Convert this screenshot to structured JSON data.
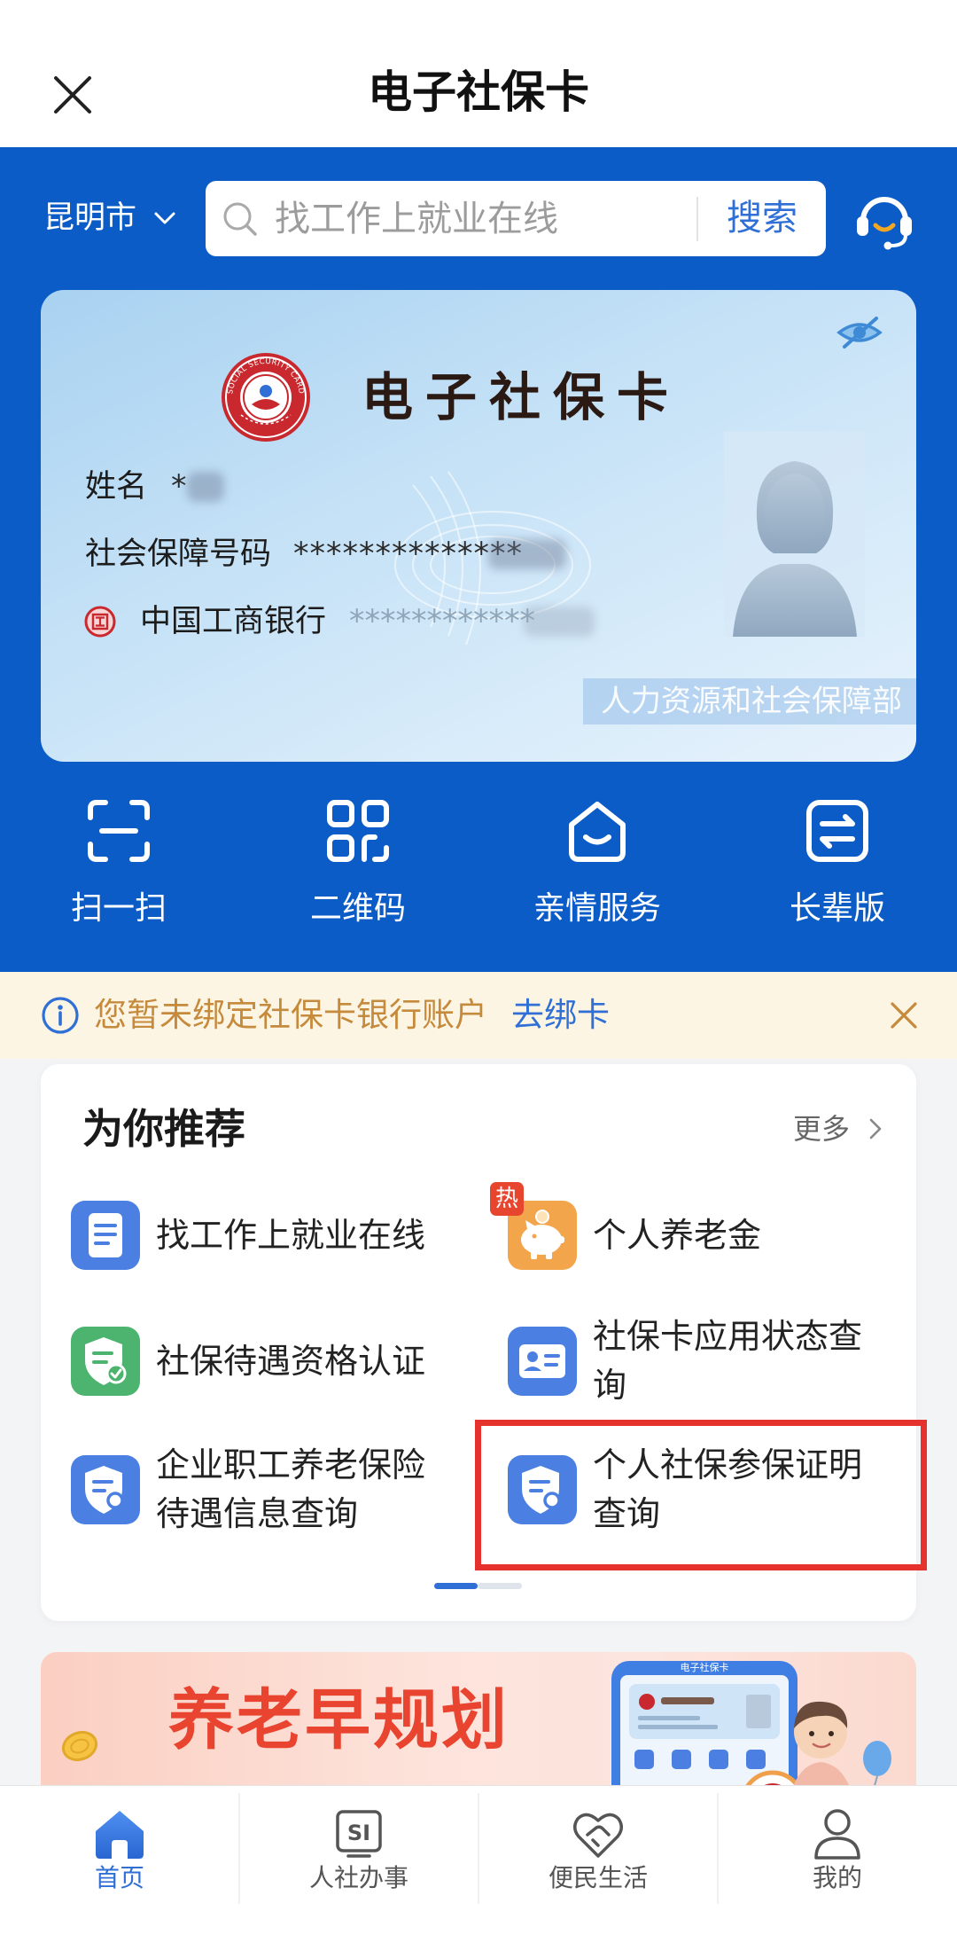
{
  "header": {
    "title": "电子社保卡"
  },
  "location": {
    "city": "昆明市"
  },
  "search": {
    "placeholder": "找工作上就业在线",
    "button_label": "搜索"
  },
  "card": {
    "title": "电子社保卡",
    "emblem_text": "SOCIAL SECURITY CARD",
    "name_label": "姓名",
    "name_value": "*",
    "ssn_label": "社会保障号码",
    "ssn_value": "**************",
    "bank_name": "中国工商银行",
    "bank_account": "************",
    "issuer": "人力资源和社会保障部"
  },
  "quick_actions": [
    {
      "label": "扫一扫",
      "icon": "scan-icon"
    },
    {
      "label": "二维码",
      "icon": "qr-code-icon"
    },
    {
      "label": "亲情服务",
      "icon": "family-service-icon"
    },
    {
      "label": "长辈版",
      "icon": "elder-mode-icon"
    }
  ],
  "notice": {
    "text": "您暂未绑定社保卡银行账户",
    "link": "去绑卡"
  },
  "recommend": {
    "title": "为你推荐",
    "more": "更多",
    "hot_badge": "热",
    "items": [
      {
        "label": "找工作上就业在线",
        "icon": "document-icon"
      },
      {
        "label": "个人养老金",
        "icon": "piggy-bank-icon",
        "hot": true
      },
      {
        "label": "社保待遇资格认证",
        "icon": "shield-check-icon"
      },
      {
        "label": "社保卡应用状态查询",
        "icon": "id-card-icon"
      },
      {
        "label": "企业职工养老保险待遇信息查询",
        "icon": "shield-search-icon"
      },
      {
        "label": "个人社保参保证明查询",
        "icon": "shield-search-icon",
        "highlighted": true
      }
    ],
    "active_page": 1,
    "page_count": 2
  },
  "banner": {
    "title": "养老早规划",
    "phone_title": "电子社保卡"
  },
  "nav": [
    {
      "label": "首页",
      "icon": "home-icon",
      "active": true
    },
    {
      "label": "人社办事",
      "icon": "si-service-icon",
      "icon_text": "SI"
    },
    {
      "label": "便民生活",
      "icon": "heart-hands-icon"
    },
    {
      "label": "我的",
      "icon": "user-icon"
    }
  ],
  "colors": {
    "brand_blue": "#0b5cc7",
    "link_blue": "#2f6fd6",
    "notice_bg": "#fdf5e4",
    "notice_text": "#c58a3b",
    "highlight": "#e5322d",
    "hot_badge": "#e8452f",
    "banner_title": "#e8442f"
  }
}
